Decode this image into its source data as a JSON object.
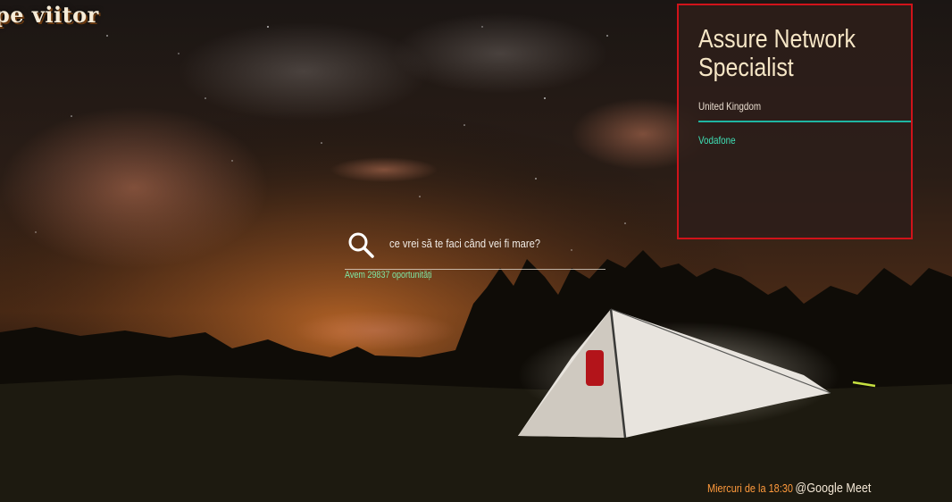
{
  "brand": {
    "text": "pe viitor"
  },
  "job_card": {
    "title": "Assure Network Specialist",
    "location": "United Kingdom",
    "company": "Vodafone"
  },
  "search": {
    "placeholder": "ce vrei să te faci când vei fi mare?",
    "icon": "search-icon"
  },
  "opportunities_text": "Avem 29837 oportunități",
  "event": {
    "time_text": "Miercuri de la 18:30",
    "platform": "@Google Meet"
  },
  "colors": {
    "card_border": "#d0131a",
    "divider": "#1fb5a2",
    "company": "#3fe0b6",
    "opportunities": "#7ee8a4",
    "event_time": "#ff9a3c"
  }
}
